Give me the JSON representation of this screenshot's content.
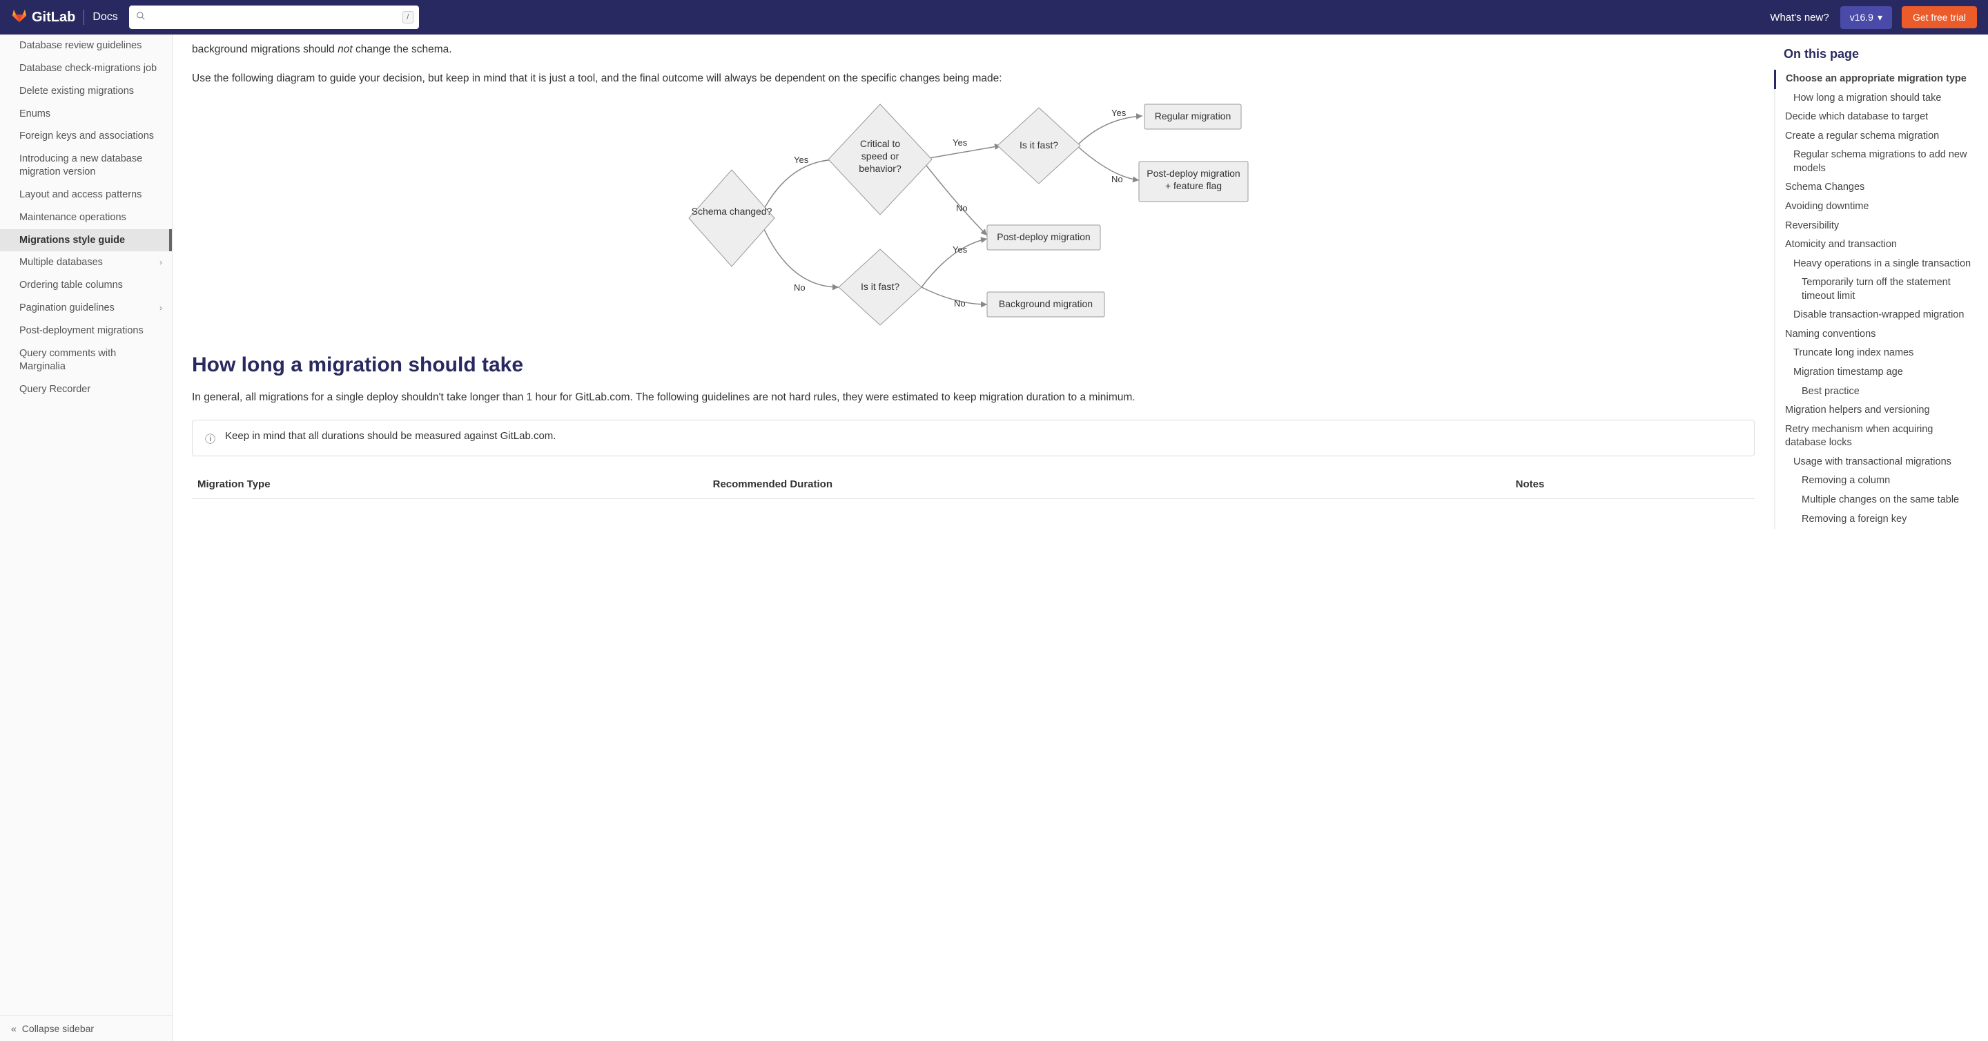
{
  "header": {
    "brand": "GitLab",
    "docs": "Docs",
    "search_placeholder": "",
    "slash": "/",
    "whats_new": "What's new?",
    "version": "v16.9",
    "trial": "Get free trial"
  },
  "sidebar": {
    "items": [
      {
        "label": "Database review guidelines",
        "active": false
      },
      {
        "label": "Database check-migrations job",
        "active": false
      },
      {
        "label": "Delete existing migrations",
        "active": false
      },
      {
        "label": "Enums",
        "active": false
      },
      {
        "label": "Foreign keys and associations",
        "active": false
      },
      {
        "label": "Introducing a new database migration version",
        "active": false
      },
      {
        "label": "Layout and access patterns",
        "active": false
      },
      {
        "label": "Maintenance operations",
        "active": false
      },
      {
        "label": "Migrations style guide",
        "active": true
      },
      {
        "label": "Multiple databases",
        "active": false,
        "expandable": true
      },
      {
        "label": "Ordering table columns",
        "active": false
      },
      {
        "label": "Pagination guidelines",
        "active": false,
        "expandable": true
      },
      {
        "label": "Post-deployment migrations",
        "active": false
      },
      {
        "label": "Query comments with Marginalia",
        "active": false
      },
      {
        "label": "Query Recorder",
        "active": false
      }
    ],
    "collapse": "Collapse sidebar"
  },
  "content": {
    "intro_trail": "background migrations should ",
    "intro_not": "not",
    "intro_trail2": " change the schema.",
    "intro2": "Use the following diagram to guide your decision, but keep in mind that it is just a tool, and the final outcome will always be dependent on the specific changes being made:",
    "diagram": {
      "schema": "Schema changed?",
      "critical": "Critical to speed or behavior?",
      "fast1": "Is it fast?",
      "fast2": "Is it fast?",
      "regular": "Regular migration",
      "postflag": "Post-deploy migration + feature flag",
      "post": "Post-deploy migration",
      "bg": "Background migration",
      "yes": "Yes",
      "no": "No"
    },
    "heading": "How long a migration should take",
    "body1": "In general, all migrations for a single deploy shouldn't take longer than 1 hour for GitLab.com. The following guidelines are not hard rules, they were estimated to keep migration duration to a minimum.",
    "info": "Keep in mind that all durations should be measured against GitLab.com.",
    "table": {
      "col1": "Migration Type",
      "col2": "Recommended Duration",
      "col3": "Notes"
    }
  },
  "toc": {
    "heading": "On this page",
    "items": [
      {
        "label": "Choose an appropriate migration type",
        "lvl": 1,
        "active": true
      },
      {
        "label": "How long a migration should take",
        "lvl": 2
      },
      {
        "label": "Decide which database to target",
        "lvl": 1
      },
      {
        "label": "Create a regular schema migration",
        "lvl": 1
      },
      {
        "label": "Regular schema migrations to add new models",
        "lvl": 2
      },
      {
        "label": "Schema Changes",
        "lvl": 1
      },
      {
        "label": "Avoiding downtime",
        "lvl": 1
      },
      {
        "label": "Reversibility",
        "lvl": 1
      },
      {
        "label": "Atomicity and transaction",
        "lvl": 1
      },
      {
        "label": "Heavy operations in a single transaction",
        "lvl": 2
      },
      {
        "label": "Temporarily turn off the statement timeout limit",
        "lvl": 3
      },
      {
        "label": "Disable transaction-wrapped migration",
        "lvl": 2
      },
      {
        "label": "Naming conventions",
        "lvl": 1
      },
      {
        "label": "Truncate long index names",
        "lvl": 2
      },
      {
        "label": "Migration timestamp age",
        "lvl": 2
      },
      {
        "label": "Best practice",
        "lvl": 3
      },
      {
        "label": "Migration helpers and versioning",
        "lvl": 1
      },
      {
        "label": "Retry mechanism when acquiring database locks",
        "lvl": 1
      },
      {
        "label": "Usage with transactional migrations",
        "lvl": 2
      },
      {
        "label": "Removing a column",
        "lvl": 3
      },
      {
        "label": "Multiple changes on the same table",
        "lvl": 3
      },
      {
        "label": "Removing a foreign key",
        "lvl": 3
      }
    ]
  }
}
